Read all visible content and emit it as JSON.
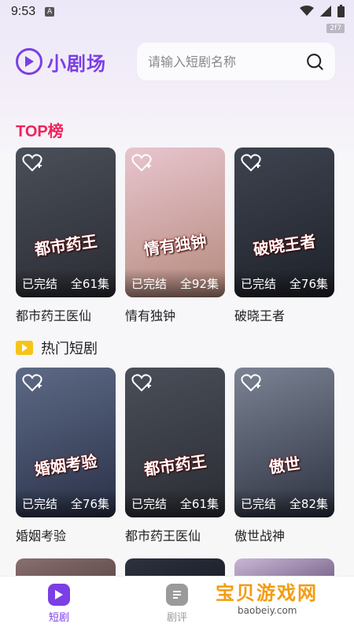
{
  "status_bar": {
    "time": "9:53",
    "notif_badge": "A",
    "speed": "2f7"
  },
  "header": {
    "app_name": "小剧场",
    "search_placeholder": "请输入短剧名称"
  },
  "sections": {
    "top_title": "TOP榜",
    "hot_title": "热门短剧"
  },
  "top_list": [
    {
      "title": "都市药王医仙",
      "status": "已完结",
      "episodes": "全61集",
      "poster_text": "都市药王",
      "poster_colors": [
        "#4a4f59",
        "#2a2c33"
      ]
    },
    {
      "title": "情有独钟",
      "status": "已完结",
      "episodes": "全92集",
      "poster_text": "情有独钟",
      "poster_colors": [
        "#e8c5cf",
        "#b58a7c"
      ]
    },
    {
      "title": "破晓王者",
      "status": "已完结",
      "episodes": "全76集",
      "poster_text": "破晓王者",
      "poster_colors": [
        "#3e4450",
        "#1e2129"
      ]
    }
  ],
  "hot_list": [
    {
      "title": "婚姻考验",
      "status": "已完结",
      "episodes": "全76集",
      "poster_text": "婚姻考验",
      "poster_colors": [
        "#5d6a86",
        "#2a3148"
      ]
    },
    {
      "title": "都市药王医仙",
      "status": "已完结",
      "episodes": "全61集",
      "poster_text": "都市药王",
      "poster_colors": [
        "#4a4f59",
        "#2a2c33"
      ]
    },
    {
      "title": "傲世战神",
      "status": "已完结",
      "episodes": "全82集",
      "poster_text": "傲世",
      "poster_colors": [
        "#7b8394",
        "#2d3240"
      ]
    }
  ],
  "row3_colors": [
    [
      "#8a6f6f",
      "#5a4747"
    ],
    [
      "#2d3240",
      "#1a1d26"
    ],
    [
      "#c9b7d6",
      "#6f5a80"
    ]
  ],
  "tabs": [
    {
      "label": "短剧",
      "icon": "play-icon",
      "active": true
    },
    {
      "label": "剧评",
      "icon": "review-icon",
      "active": false
    }
  ],
  "watermark": {
    "main": "宝贝游戏网",
    "sub": "baobeiy.com"
  },
  "colors": {
    "accent": "#7b3fe4",
    "top_red": "#f0225b",
    "hot_yellow": "#f6c417"
  }
}
